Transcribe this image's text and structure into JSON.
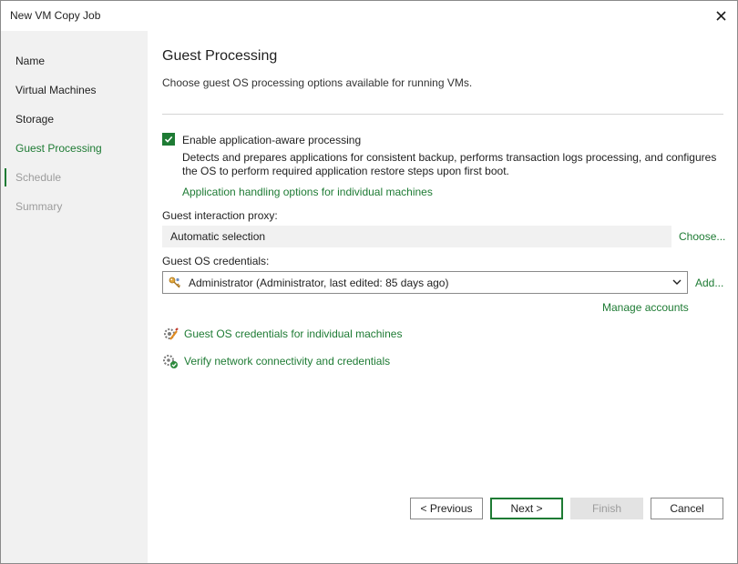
{
  "window": {
    "title": "New VM Copy Job"
  },
  "sidebar": {
    "items": [
      {
        "label": "Name"
      },
      {
        "label": "Virtual Machines"
      },
      {
        "label": "Storage"
      },
      {
        "label": "Guest Processing"
      },
      {
        "label": "Schedule"
      },
      {
        "label": "Summary"
      }
    ],
    "active_item": "Guest Processing"
  },
  "page": {
    "title": "Guest Processing",
    "subtitle": "Choose guest OS processing options available for running VMs."
  },
  "app_aware": {
    "checked": true,
    "label": "Enable application-aware processing",
    "description": "Detects and prepares applications for consistent backup, performs transaction logs processing, and configures the OS to perform required application restore steps upon first boot.",
    "link": "Application handling options for individual machines"
  },
  "proxy": {
    "label": "Guest interaction proxy:",
    "value": "Automatic selection",
    "choose_link": "Choose..."
  },
  "credentials": {
    "label": "Guest OS credentials:",
    "value": "Administrator (Administrator, last edited: 85 days ago)",
    "add_link": "Add...",
    "manage_link": "Manage accounts",
    "icon": "key-icon"
  },
  "actions": [
    {
      "label": "Guest OS credentials for individual machines",
      "icon": "credentials-edit-icon"
    },
    {
      "label": "Verify network connectivity and credentials",
      "icon": "network-verify-icon"
    }
  ],
  "footer": {
    "previous": "< Previous",
    "next": "Next >",
    "finish": "Finish",
    "cancel": "Cancel"
  },
  "colors": {
    "accent": "#1e7b34",
    "sidebar_bg": "#f1f1f1",
    "disabled_text": "#9c9c9c"
  }
}
